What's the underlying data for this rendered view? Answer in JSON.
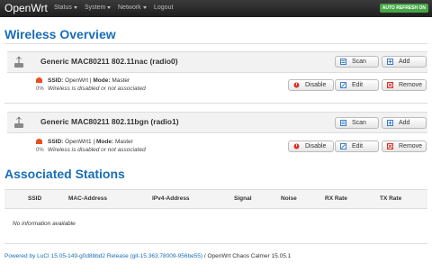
{
  "nav": {
    "brand": "OpenWrt",
    "items": [
      {
        "label": "Status",
        "dropdown": true
      },
      {
        "label": "System",
        "dropdown": true
      },
      {
        "label": "Network",
        "dropdown": true
      },
      {
        "label": "Logout",
        "dropdown": false
      }
    ],
    "auto_refresh": "AUTO REFRESH ON"
  },
  "page_title": "Wireless Overview",
  "radios": [
    {
      "title": "Generic MAC80211 802.11nac (radio0)",
      "scan_label": "Scan",
      "add_label": "Add",
      "network": {
        "signal": "0%",
        "ssid_label": "SSID:",
        "ssid": "OpenWrt",
        "sep": " | ",
        "mode_label": "Mode:",
        "mode": "Master",
        "status": "Wireless is disabled or not associated",
        "disable_label": "Disable",
        "edit_label": "Edit",
        "remove_label": "Remove"
      }
    },
    {
      "title": "Generic MAC80211 802.11bgn (radio1)",
      "scan_label": "Scan",
      "add_label": "Add",
      "network": {
        "signal": "0%",
        "ssid_label": "SSID:",
        "ssid": "OpenWrt1",
        "sep": " | ",
        "mode_label": "Mode:",
        "mode": "Master",
        "status": "Wireless is disabled or not associated",
        "disable_label": "Disable",
        "edit_label": "Edit",
        "remove_label": "Remove"
      }
    }
  ],
  "associated": {
    "title": "Associated Stations",
    "columns": [
      "SSID",
      "MAC-Address",
      "IPv4-Address",
      "Signal",
      "Noise",
      "RX Rate",
      "TX Rate"
    ],
    "empty_text": "No information available"
  },
  "footer": {
    "link_text": "Powered by LuCI 15.05-149-g0d8bbd2 Release (git-15.363.78009-956be55)",
    "rest_text": " / OpenWrt Chaos Calmer 15.05.1"
  },
  "colors": {
    "accent": "#1a6eb6",
    "auto_refresh": "#46a546",
    "navbar": "#222222"
  }
}
